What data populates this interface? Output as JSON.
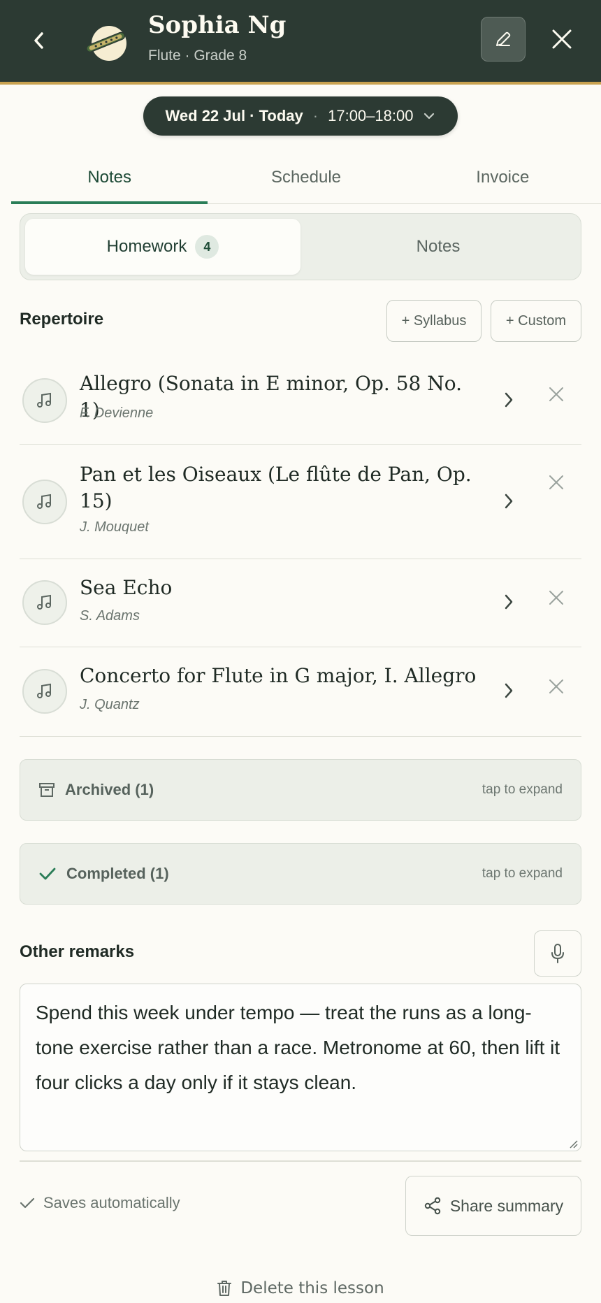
{
  "header": {
    "student_name": "Sophia Ng",
    "subtitle": "Flute · Grade 8"
  },
  "lesson": {
    "date": "Wed 22 Jul · Today",
    "separator": "·",
    "time": "17:00–18:00"
  },
  "tabs": [
    {
      "label": "Notes",
      "active": true
    },
    {
      "label": "Schedule",
      "active": false
    },
    {
      "label": "Invoice",
      "active": false
    }
  ],
  "segments": {
    "homework_label": "Homework",
    "homework_count": "4",
    "notes_label": "Notes"
  },
  "repertoire": {
    "title": "Repertoire",
    "syllabus_button": "+ Syllabus",
    "custom_button": "+ Custom",
    "items": [
      {
        "title": "Allegro (Sonata in E minor, Op. 58 No. 1)",
        "composer": "F. Devienne"
      },
      {
        "title": "Pan et les Oiseaux (Le flûte de Pan, Op. 15)",
        "composer": "J. Mouquet"
      },
      {
        "title": "Sea Echo",
        "composer": "S. Adams"
      },
      {
        "title": "Concerto for Flute in G major, I. Allegro",
        "composer": "J. Quantz"
      }
    ]
  },
  "archived": {
    "label": "Archived (1)",
    "hint": "tap to expand"
  },
  "completed": {
    "label": "Completed (1)",
    "hint": "tap to expand"
  },
  "remarks": {
    "title": "Other remarks",
    "text": "Spend this week under tempo — treat the runs as a long-tone exercise rather than a race. Metronome at 60, then lift it four clicks a day only if it stays clean."
  },
  "footer": {
    "saves_text": "Saves automatically",
    "share_label": "Share summary",
    "delete_label": "Delete this lesson"
  },
  "colors": {
    "header_bg": "#2c3a33",
    "accent_gold": "#c9a250",
    "accent_green": "#2a7d57"
  }
}
